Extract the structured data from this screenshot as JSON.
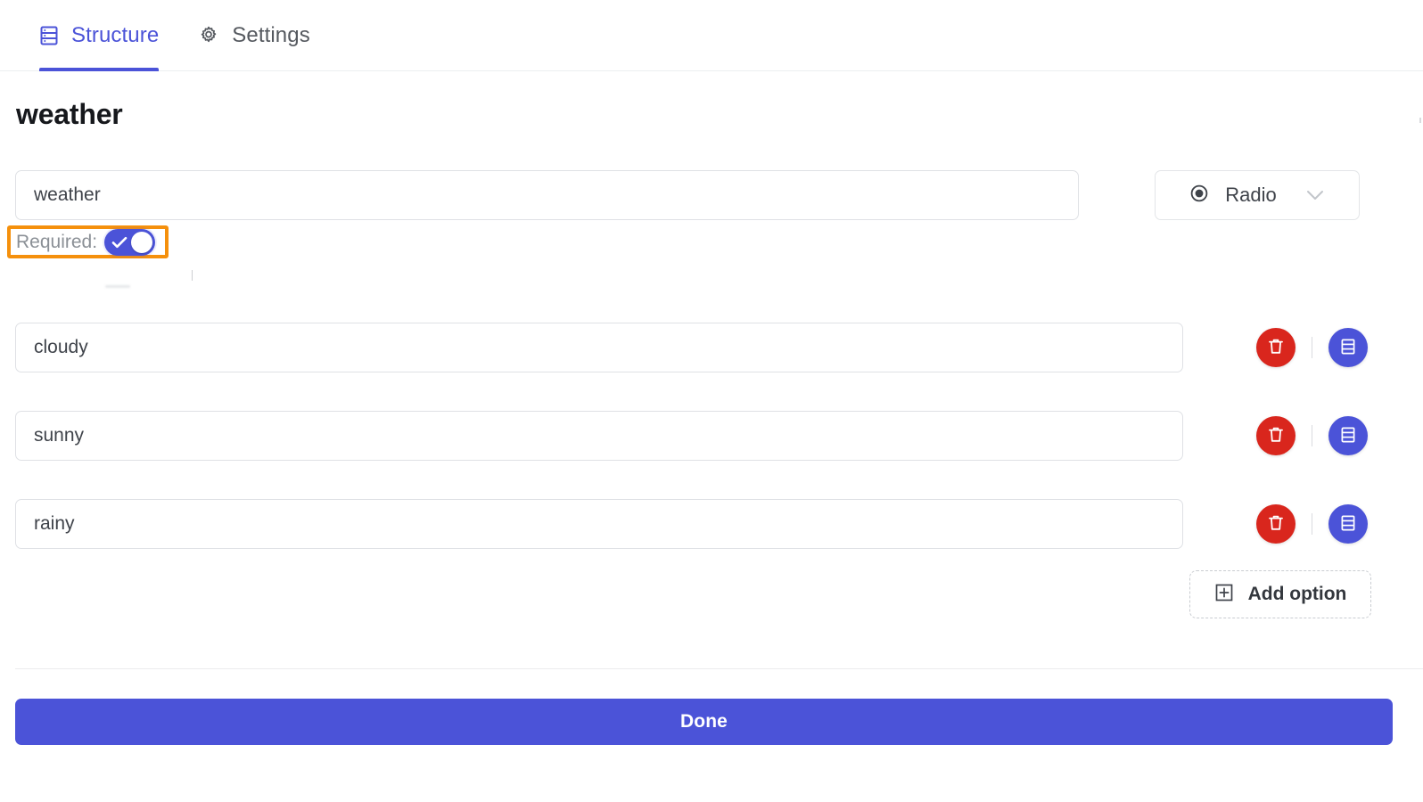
{
  "tabs": [
    {
      "label": "Structure",
      "icon": "list-rows-icon",
      "active": true
    },
    {
      "label": "Settings",
      "icon": "gear-icon",
      "active": false
    }
  ],
  "page": {
    "title": "weather"
  },
  "field": {
    "name_value": "weather",
    "name_placeholder": "Field name",
    "type_value": "Radio",
    "type_icon": "radio-button-icon",
    "chevron_icon": "chevron-down-icon"
  },
  "required": {
    "label": "Required:",
    "enabled": true,
    "highlight_color": "#f5900c",
    "on_color": "#4b53d8",
    "check_icon": "check-icon"
  },
  "options": [
    {
      "value": "cloudy",
      "placeholder": "Option",
      "delete_icon": "trash-icon",
      "drag_icon": "list-rows-icon"
    },
    {
      "value": "sunny",
      "placeholder": "Option",
      "delete_icon": "trash-icon",
      "drag_icon": "list-rows-icon"
    },
    {
      "value": "rainy",
      "placeholder": "Option",
      "delete_icon": "trash-icon",
      "drag_icon": "list-rows-icon"
    }
  ],
  "add_option": {
    "label": "Add option",
    "icon": "plus-square-icon"
  },
  "footer": {
    "done_label": "Done"
  },
  "colors": {
    "accent": "#4b53d8",
    "danger": "#d9261d",
    "highlight": "#f5900c",
    "text": "#3f434a",
    "muted": "#8b9096"
  }
}
